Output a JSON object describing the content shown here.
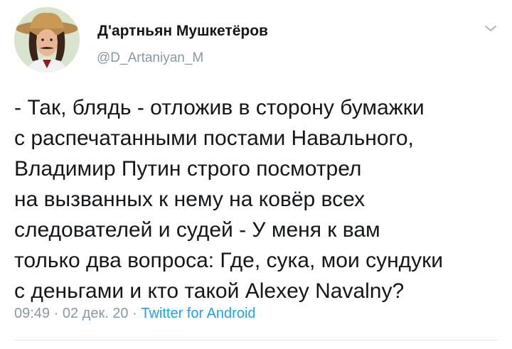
{
  "author": {
    "name": "Д'артньян Мушкетёров",
    "handle": "@D_Artaniyan_M",
    "avatar_icon": "musketeer-avatar"
  },
  "menu_icon": "chevron-down-icon",
  "tweet": {
    "lines": [
      "- Так, блядь - отложив в сторону бумажки",
      "с распечатанными постами Навального,",
      "Владимир Путин строго посмотрел",
      "на вызванных к нему на ковёр всех",
      "следователей и судей - У меня к вам",
      "только два вопроса: Где, сука, мои сундуки",
      "с деньгами и кто такой Alexey Navalny?"
    ]
  },
  "meta": {
    "time": "09:49",
    "separator1": " · ",
    "date": "02 дек. 20",
    "separator2": " · ",
    "source": "Twitter for Android"
  },
  "colors": {
    "text": "#14171a",
    "muted": "#8899a6",
    "link": "#1da1f2"
  }
}
